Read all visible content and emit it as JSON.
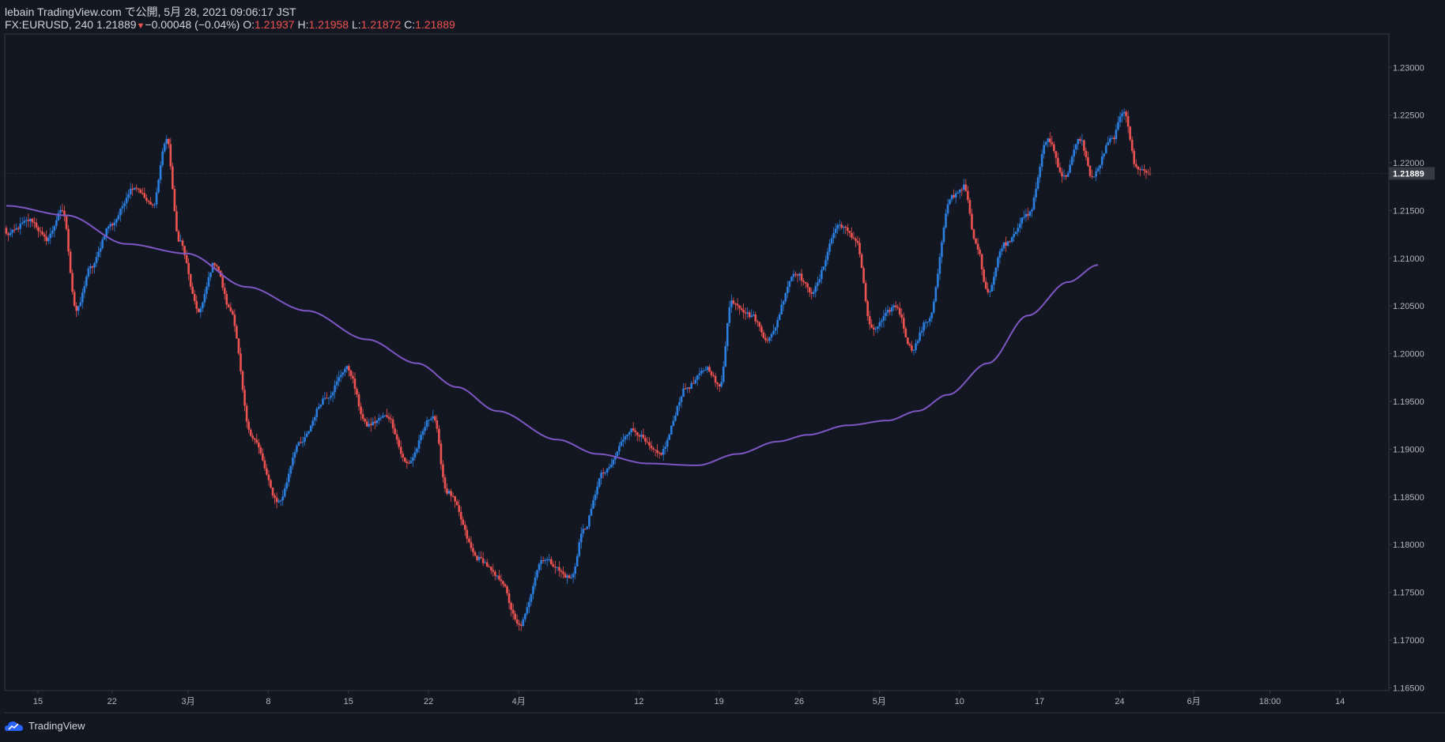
{
  "header": {
    "published": "lebain TradingView.com で公開, 5月 28, 2021 09:06:17 JST",
    "symbol": "FX:EURUSD, 240",
    "last": "1.21889",
    "change_arrow": "▼",
    "change": "−0.00048 (−0.04%)",
    "o_label": "O:",
    "o_value": "1.21937",
    "h_label": "H:",
    "h_value": "1.21958",
    "l_label": "L:",
    "l_value": "1.21872",
    "c_label": "C:",
    "c_value": "1.21889"
  },
  "footer": {
    "brand": "TradingView"
  },
  "colors": {
    "background": "#131722",
    "up": "#2a7fe0",
    "down": "#ef5350",
    "ma": "#7e57c2",
    "axis_text": "#b2b5be",
    "grid_border": "#363a45",
    "price_label_bg": "#363a45"
  },
  "chart_data": {
    "type": "candlestick",
    "symbol": "FX:EURUSD",
    "interval": "240",
    "y_ticks": [
      1.165,
      1.17,
      1.175,
      1.18,
      1.185,
      1.19,
      1.195,
      1.2,
      1.205,
      1.21,
      1.215,
      1.22,
      1.225,
      1.23
    ],
    "y_tick_labels": [
      "1.16500",
      "1.17000",
      "1.17500",
      "1.18000",
      "1.18500",
      "1.19000",
      "1.19500",
      "1.20000",
      "1.20500",
      "1.21000",
      "1.21500",
      "1.22000",
      "1.22500",
      "1.23000"
    ],
    "ylim": [
      1.1647,
      1.2335
    ],
    "current_price": 1.21889,
    "current_price_label": "1.21889",
    "x_labels": [
      "15",
      "22",
      "3月",
      "8",
      "15",
      "22",
      "4月",
      "12",
      "19",
      "26",
      "5月",
      "10",
      "17",
      "24",
      "6月",
      "18:00",
      "14"
    ],
    "x_label_bars": [
      0,
      37,
      75,
      115,
      155,
      195,
      240,
      300,
      340,
      380,
      420,
      460,
      500,
      540,
      577,
      615,
      650
    ],
    "n_bars_plotted": 572,
    "close_anchors": [
      [
        0,
        1.2125
      ],
      [
        12,
        1.214
      ],
      [
        20,
        1.212
      ],
      [
        28,
        1.215
      ],
      [
        35,
        1.2045
      ],
      [
        42,
        1.209
      ],
      [
        52,
        1.2135
      ],
      [
        64,
        1.2175
      ],
      [
        73,
        1.2155
      ],
      [
        80,
        1.2225
      ],
      [
        86,
        1.212
      ],
      [
        96,
        1.2045
      ],
      [
        104,
        1.2095
      ],
      [
        112,
        1.2045
      ],
      [
        122,
        1.1915
      ],
      [
        136,
        1.1845
      ],
      [
        146,
        1.1905
      ],
      [
        160,
        1.1955
      ],
      [
        170,
        1.1985
      ],
      [
        180,
        1.1925
      ],
      [
        190,
        1.1935
      ],
      [
        200,
        1.1885
      ],
      [
        213,
        1.1935
      ],
      [
        220,
        1.1855
      ],
      [
        236,
        1.1785
      ],
      [
        246,
        1.1765
      ],
      [
        256,
        1.1715
      ],
      [
        268,
        1.1785
      ],
      [
        282,
        1.1765
      ],
      [
        288,
        1.1815
      ],
      [
        298,
        1.1875
      ],
      [
        312,
        1.192
      ],
      [
        326,
        1.1895
      ],
      [
        340,
        1.1965
      ],
      [
        350,
        1.1985
      ],
      [
        356,
        1.1965
      ],
      [
        362,
        1.2055
      ],
      [
        372,
        1.204
      ],
      [
        380,
        1.2015
      ],
      [
        394,
        1.2085
      ],
      [
        402,
        1.2065
      ],
      [
        416,
        1.2135
      ],
      [
        424,
        1.212
      ],
      [
        432,
        1.2025
      ],
      [
        444,
        1.205
      ],
      [
        452,
        1.2005
      ],
      [
        460,
        1.2035
      ],
      [
        472,
        1.2165
      ],
      [
        478,
        1.2175
      ],
      [
        484,
        1.2115
      ],
      [
        490,
        1.2065
      ],
      [
        498,
        1.2115
      ],
      [
        510,
        1.2145
      ],
      [
        520,
        1.2225
      ],
      [
        528,
        1.2185
      ],
      [
        536,
        1.2225
      ],
      [
        542,
        1.2185
      ],
      [
        552,
        1.2225
      ],
      [
        558,
        1.2255
      ],
      [
        564,
        1.2195
      ],
      [
        571,
        1.21889
      ]
    ],
    "close_noise": 0.00025,
    "ma": {
      "name": "",
      "anchors": [
        [
          0,
          1.2155
        ],
        [
          30,
          1.2145
        ],
        [
          60,
          1.2115
        ],
        [
          90,
          1.2105
        ],
        [
          120,
          1.207
        ],
        [
          150,
          1.2045
        ],
        [
          180,
          1.2015
        ],
        [
          205,
          1.199
        ],
        [
          225,
          1.1965
        ],
        [
          245,
          1.194
        ],
        [
          275,
          1.191
        ],
        [
          295,
          1.1895
        ],
        [
          320,
          1.1885
        ],
        [
          345,
          1.1883
        ],
        [
          365,
          1.1895
        ],
        [
          385,
          1.1908
        ],
        [
          400,
          1.1915
        ],
        [
          420,
          1.1925
        ],
        [
          440,
          1.193
        ],
        [
          455,
          1.194
        ],
        [
          470,
          1.1957
        ],
        [
          490,
          1.199
        ],
        [
          510,
          1.204
        ],
        [
          530,
          1.2075
        ],
        [
          545,
          1.2093
        ]
      ]
    }
  }
}
